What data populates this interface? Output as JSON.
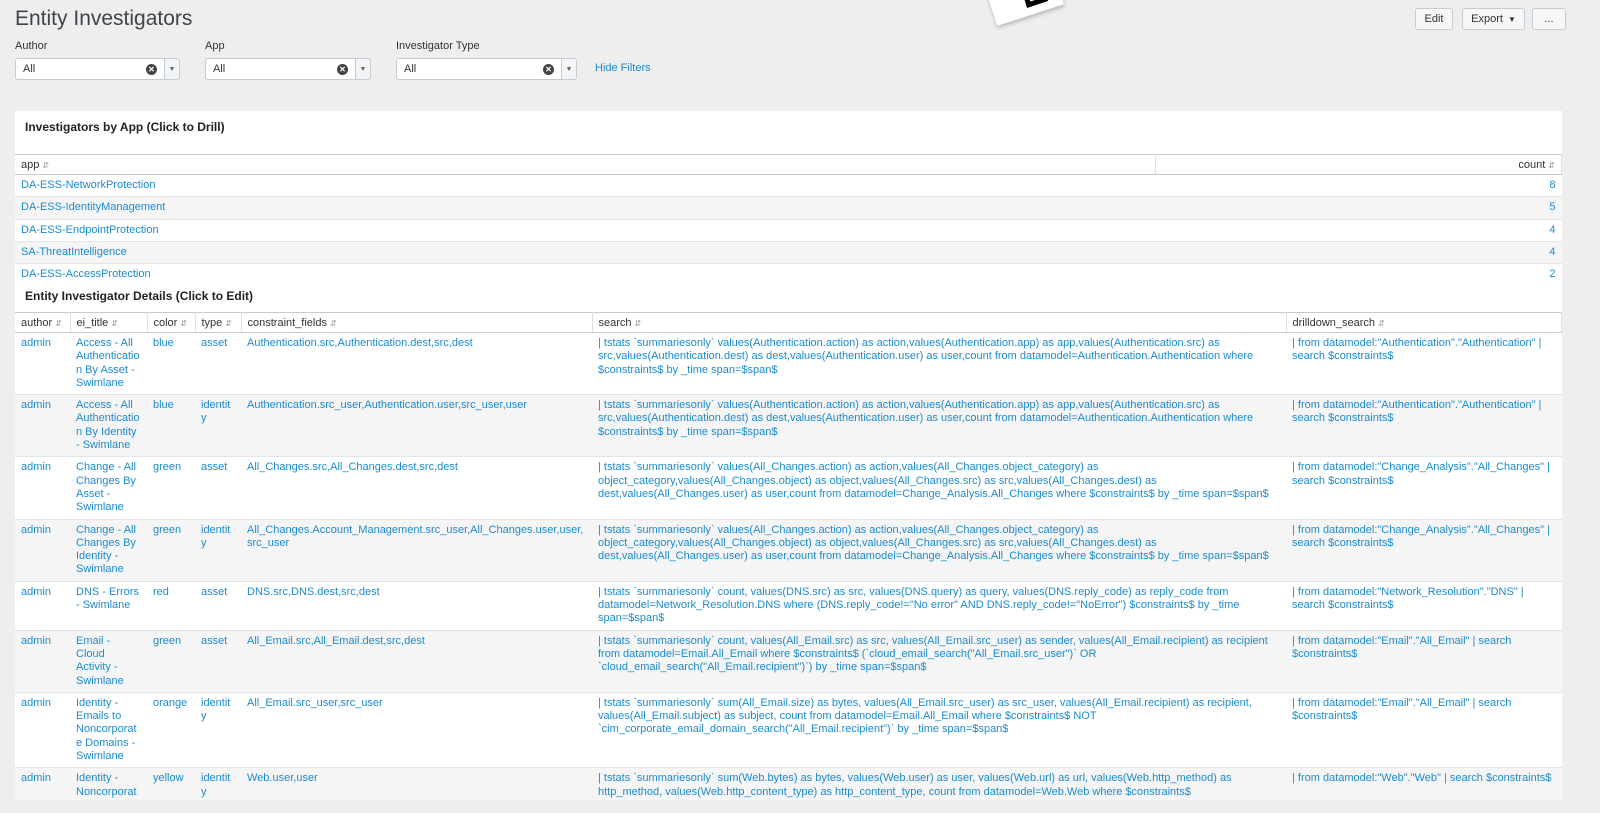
{
  "page": {
    "title": "Entity Investigators"
  },
  "toolbar": {
    "edit_label": "Edit",
    "export_label": "Export",
    "more_label": "..."
  },
  "filters": [
    {
      "label": "Author",
      "value": "All"
    },
    {
      "label": "App",
      "value": "All"
    },
    {
      "label": "Investigator Type",
      "value": "All"
    }
  ],
  "hide_filters_label": "Hide Filters",
  "panel1": {
    "title": "Investigators by App (Click to Drill)",
    "columns": [
      "app",
      "count"
    ],
    "rows": [
      {
        "app": "DA-ESS-NetworkProtection",
        "count": "8"
      },
      {
        "app": "DA-ESS-IdentityManagement",
        "count": "5"
      },
      {
        "app": "DA-ESS-EndpointProtection",
        "count": "4"
      },
      {
        "app": "SA-ThreatIntelligence",
        "count": "4"
      },
      {
        "app": "DA-ESS-AccessProtection",
        "count": "2"
      }
    ]
  },
  "panel2": {
    "title": "Entity Investigator Details (Click to Edit)",
    "columns": [
      "author",
      "ei_title",
      "color",
      "type",
      "constraint_fields",
      "search",
      "drilldown_search"
    ],
    "rows": [
      {
        "author": "admin",
        "ei_title": "Access - All Authentication By Asset - Swimlane",
        "color": "blue",
        "type": "asset",
        "constraint_fields": "Authentication.src,Authentication.dest,src,dest",
        "search": "| tstats `summariesonly` values(Authentication.action) as action,values(Authentication.app) as app,values(Authentication.src) as src,values(Authentication.dest) as dest,values(Authentication.user) as user,count from datamodel=Authentication.Authentication where $constraints$ by _time span=$span$",
        "drilldown_search": "| from datamodel:\"Authentication\".\"Authentication\" | search $constraints$"
      },
      {
        "author": "admin",
        "ei_title": "Access - All Authentication By Identity - Swimlane",
        "color": "blue",
        "type": "identity",
        "constraint_fields": "Authentication.src_user,Authentication.user,src_user,user",
        "search": "| tstats `summariesonly` values(Authentication.action) as action,values(Authentication.app) as app,values(Authentication.src) as src,values(Authentication.dest) as dest,values(Authentication.user) as user,count from datamodel=Authentication.Authentication where $constraints$ by _time span=$span$",
        "drilldown_search": "| from datamodel:\"Authentication\".\"Authentication\" | search $constraints$"
      },
      {
        "author": "admin",
        "ei_title": "Change - All Changes By Asset - Swimlane",
        "color": "green",
        "type": "asset",
        "constraint_fields": "All_Changes.src,All_Changes.dest,src,dest",
        "search": "| tstats `summariesonly` values(All_Changes.action) as action,values(All_Changes.object_category) as object_category,values(All_Changes.object) as object,values(All_Changes.src) as src,values(All_Changes.dest) as dest,values(All_Changes.user) as user,count from datamodel=Change_Analysis.All_Changes where $constraints$ by _time span=$span$",
        "drilldown_search": "| from datamodel:\"Change_Analysis\".\"All_Changes\" | search $constraints$"
      },
      {
        "author": "admin",
        "ei_title": "Change - All Changes By Identity - Swimlane",
        "color": "green",
        "type": "identity",
        "constraint_fields": "All_Changes.Account_Management.src_user,All_Changes.user,user,src_user",
        "search": "| tstats `summariesonly` values(All_Changes.action) as action,values(All_Changes.object_category) as object_category,values(All_Changes.object) as object,values(All_Changes.src) as src,values(All_Changes.dest) as dest,values(All_Changes.user) as user,count from datamodel=Change_Analysis.All_Changes where $constraints$ by _time span=$span$",
        "drilldown_search": "| from datamodel:\"Change_Analysis\".\"All_Changes\" | search $constraints$"
      },
      {
        "author": "admin",
        "ei_title": "DNS - Errors - Swimlane",
        "color": "red",
        "type": "asset",
        "constraint_fields": "DNS.src,DNS.dest,src,dest",
        "search": "| tstats `summariesonly` count, values(DNS.src) as src, values(DNS.query) as query, values(DNS.reply_code) as reply_code from datamodel=Network_Resolution.DNS where (DNS.reply_code!=\"No error\" AND DNS.reply_code!=\"NoError\") $constraints$ by _time span=$span$",
        "drilldown_search": "| from datamodel:\"Network_Resolution\".\"DNS\" | search $constraints$"
      },
      {
        "author": "admin",
        "ei_title": "Email - Cloud Activity - Swimlane",
        "color": "green",
        "type": "asset",
        "constraint_fields": "All_Email.src,All_Email.dest,src,dest",
        "search": "| tstats `summariesonly` count, values(All_Email.src) as src, values(All_Email.src_user) as sender, values(All_Email.recipient) as recipient from datamodel=Email.All_Email where $constraints$ (`cloud_email_search(\"All_Email.src_user\")` OR `cloud_email_search(\"All_Email.recipient\")`) by _time span=$span$",
        "drilldown_search": "| from datamodel:\"Email\".\"All_Email\" | search $constraints$"
      },
      {
        "author": "admin",
        "ei_title": "Identity - Emails to Noncorporate Domains - Swimlane",
        "color": "orange",
        "type": "identity",
        "constraint_fields": "All_Email.src_user,src_user",
        "search": "| tstats `summariesonly` sum(All_Email.size) as bytes, values(All_Email.src_user) as src_user, values(All_Email.recipient) as recipient, values(All_Email.subject) as subject, count from datamodel=Email.All_Email where $constraints$ NOT `cim_corporate_email_domain_search(\"All_Email.recipient\")` by _time span=$span$",
        "drilldown_search": "| from datamodel:\"Email\".\"All_Email\" | search $constraints$"
      },
      {
        "author": "admin",
        "ei_title": "Identity - Noncorporate Web Uploads - Swimlane",
        "color": "yellow",
        "type": "identity",
        "constraint_fields": "Web.user,user",
        "search": "| tstats `summariesonly` sum(Web.bytes) as bytes, values(Web.user) as user, values(Web.url) as url, values(Web.http_method) as http_method, values(Web.http_content_type) as http_content_type, count from datamodel=Web.Web where $constraints$ NOT(`cim_corporate_web_domain_search(\"Web.url\")`) (Web.http_method=\"POST\" OR Web.http_method=\"PUT\") by _time span=$span$ | `drop_dm_object_name(\"Web\")`",
        "drilldown_search": "| from datamodel:\"Web\".\"Web\" | search $constraints$"
      }
    ]
  }
}
